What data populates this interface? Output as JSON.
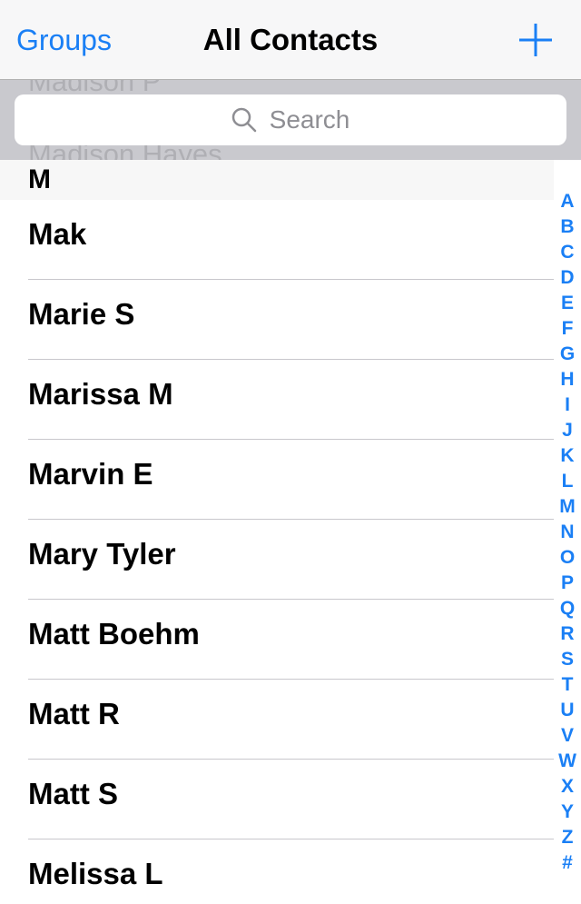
{
  "navbar": {
    "left_label": "Groups",
    "title": "All Contacts",
    "add_icon": "plus-icon"
  },
  "search": {
    "placeholder": "Search",
    "icon": "magnifier-icon",
    "ghost_above": "Madison P",
    "ghost_below": "Madison Hayes"
  },
  "section": {
    "letter": "M"
  },
  "contacts": [
    {
      "name": "Mak"
    },
    {
      "name": "Marie S"
    },
    {
      "name": "Marissa M"
    },
    {
      "name": "Marvin E"
    },
    {
      "name": "Mary Tyler"
    },
    {
      "name": "Matt Boehm"
    },
    {
      "name": "Matt R"
    },
    {
      "name": "Matt S"
    },
    {
      "name": "Melissa L"
    }
  ],
  "index": [
    "A",
    "B",
    "C",
    "D",
    "E",
    "F",
    "G",
    "H",
    "I",
    "J",
    "K",
    "L",
    "M",
    "N",
    "O",
    "P",
    "Q",
    "R",
    "S",
    "T",
    "U",
    "V",
    "W",
    "X",
    "Y",
    "Z",
    "#"
  ],
  "colors": {
    "accent": "#1a7ff5",
    "navbar_bg": "#f7f7f8",
    "search_bg": "#c9c9ce",
    "separator": "#c8c7cc"
  }
}
